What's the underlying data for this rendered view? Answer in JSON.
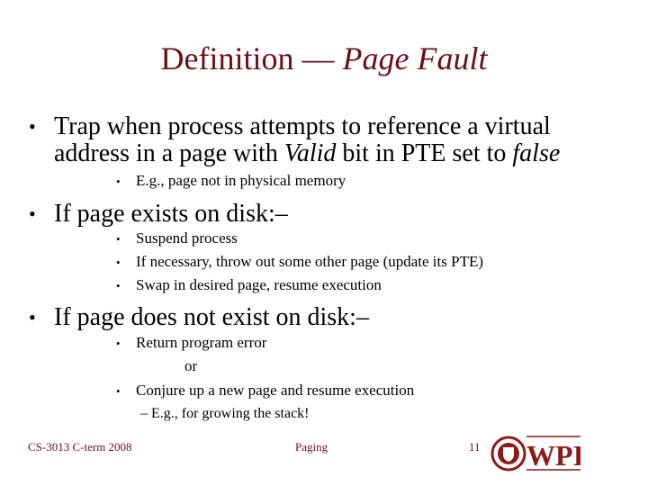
{
  "title": {
    "main": "Definition — ",
    "italic": "Page Fault"
  },
  "bullets": [
    {
      "line1": "Trap when process attempts to reference a virtual",
      "line2_pre": "address in a page with ",
      "line2_it1": "Valid",
      "line2_mid": " bit in PTE set to ",
      "line2_it2": "false",
      "sub": [
        "E.g., page not in physical memory"
      ]
    },
    {
      "text": "If page exists on disk:–",
      "sub": [
        "Suspend process",
        "If necessary, throw out some other page (update its PTE)",
        "Swap in desired page, resume execution"
      ]
    },
    {
      "text": "If page does not exist on disk:–",
      "sub": [
        "Return program error",
        "Conjure up a new page and resume execution"
      ],
      "or": "or",
      "subsub": "– E.g., for growing the stack!"
    }
  ],
  "bullet_glyph": "•",
  "footer": {
    "course": "CS-3013 C-term 2008",
    "topic": "Paging",
    "page": "11",
    "logo_text": "WPI"
  },
  "colors": {
    "title": "#6b0f1a",
    "logo": "#8b1a1a"
  }
}
